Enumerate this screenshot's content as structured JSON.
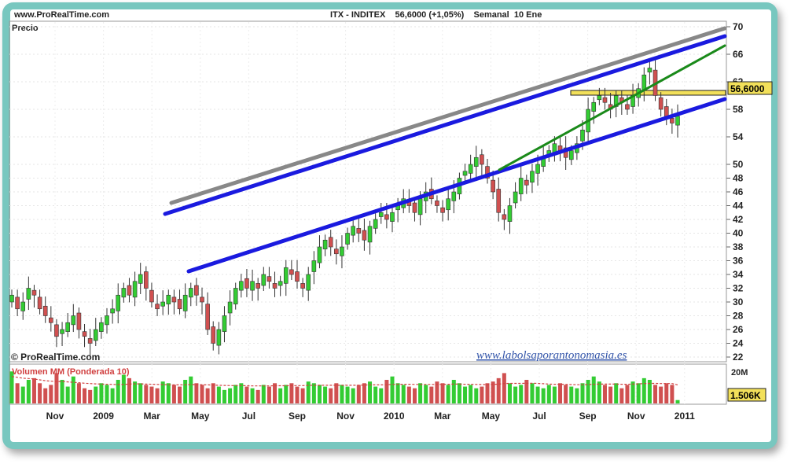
{
  "header": {
    "site": "www.ProRealTime.com",
    "title": "ITX - INDITEX    56,6000 (+1,05%)    Semanal  10 Ene"
  },
  "price_panel": {
    "label": "Precio",
    "copyright": "© ProRealTime.com",
    "watermark": "www.labolsaporantonomasia.es",
    "last_price_tag": "56,6000"
  },
  "volume_panel": {
    "label": "Volumen MM (Ponderada 10)",
    "top_tick": "20M",
    "last_volume_tag": "1.506K"
  },
  "colors": {
    "up_candle": "#33cc33",
    "down_candle": "#d05050",
    "channel_line": "#1a1adf",
    "outer_line": "#888888",
    "trend_line": "#1a8a1a",
    "support_band": "#f2e05a",
    "frame": "#78c7bf"
  },
  "chart_data": [
    {
      "type": "candlestick",
      "title": "ITX - INDITEX",
      "timeframe": "Semanal",
      "last_value": 56.6,
      "change_pct": 1.05,
      "ylim": [
        21.5,
        71
      ],
      "y_ticks": [
        22,
        24,
        26,
        28,
        30,
        32,
        34,
        36,
        38,
        40,
        42,
        44,
        46,
        48,
        50,
        54,
        58,
        62,
        66,
        70
      ],
      "x_ticks": [
        "Nov",
        "2009",
        "Mar",
        "May",
        "Jul",
        "Sep",
        "Nov",
        "2010",
        "Mar",
        "May",
        "Jul",
        "Sep",
        "Nov",
        "2011"
      ],
      "grid": true,
      "close": [
        31,
        29,
        30,
        32,
        31,
        29,
        28,
        27,
        25,
        26,
        27,
        28,
        26,
        25,
        24,
        26,
        27,
        28,
        29,
        31,
        32,
        31,
        33,
        34,
        32,
        30,
        29,
        30,
        31,
        30,
        29,
        31,
        32,
        31,
        30,
        26,
        24,
        26,
        28,
        30,
        32,
        33,
        32,
        33,
        32,
        34,
        33,
        32,
        33,
        35,
        34,
        33,
        32,
        34,
        36,
        38,
        39,
        38,
        37,
        38,
        40,
        41,
        40,
        39,
        41,
        42,
        43,
        42,
        43,
        44,
        45,
        44,
        43,
        45,
        46,
        45,
        44,
        43,
        45,
        46,
        48,
        49,
        50,
        51,
        50,
        48,
        46,
        43,
        42,
        44,
        46,
        48,
        47,
        49,
        50,
        51,
        52,
        53,
        52,
        51,
        52,
        53,
        55,
        58,
        59,
        60,
        59,
        58,
        60,
        59,
        58,
        60,
        61,
        63,
        64,
        60,
        58,
        57,
        56,
        57
      ]
    },
    {
      "type": "bar",
      "title": "Volumen MM (Ponderada 10)",
      "ylim": [
        0,
        21
      ],
      "y_ticks": [
        "20M"
      ],
      "last_value": "1.506K",
      "values": [
        19,
        12,
        10,
        14,
        15,
        12,
        9,
        11,
        18,
        14,
        10,
        16,
        12,
        9,
        8,
        10,
        12,
        11,
        9,
        14,
        17,
        15,
        13,
        12,
        11,
        10,
        9,
        13,
        12,
        11,
        10,
        14,
        16,
        12,
        11,
        9,
        12,
        10,
        8,
        9,
        11,
        12,
        10,
        9,
        8,
        11,
        10,
        12,
        9,
        11,
        12,
        10,
        9,
        13,
        12,
        11,
        10,
        9,
        12,
        11,
        10,
        9,
        11,
        12,
        13,
        10,
        9,
        14,
        16,
        12,
        11,
        10,
        9,
        12,
        11,
        10,
        13,
        12,
        11,
        14,
        12,
        10,
        11,
        9,
        10,
        12,
        13,
        15,
        18,
        12,
        10,
        11,
        14,
        12,
        10,
        9,
        11,
        10,
        12,
        11,
        10,
        9,
        12,
        14,
        16,
        13,
        11,
        10,
        12,
        9,
        11,
        13,
        12,
        15,
        14,
        11,
        10,
        12,
        11,
        2
      ],
      "moving_average": [
        16,
        15.5,
        15,
        14.8,
        14.5,
        14,
        13.5,
        13.2,
        13,
        13,
        12.8,
        12.5,
        12.3,
        12,
        11.8,
        11.6,
        11.5,
        11.4,
        11.3,
        11.2,
        11.3,
        11.5,
        11.6,
        11.6,
        11.5,
        11.4,
        11.3,
        11.2,
        11.1,
        11,
        11,
        11.1,
        11.2,
        11.2,
        11.1,
        11,
        10.9,
        10.8,
        10.7,
        10.6,
        10.6,
        10.6,
        10.5,
        10.4,
        10.4,
        10.4,
        10.4,
        10.5,
        10.5,
        10.5,
        10.6,
        10.6,
        10.6,
        10.7,
        10.8,
        10.8,
        10.8,
        10.8,
        10.8,
        10.8,
        10.8,
        10.8,
        10.8,
        10.9,
        11,
        11,
        11,
        11.1,
        11.3,
        11.4,
        11.4,
        11.4,
        11.3,
        11.3,
        11.3,
        11.3,
        11.3,
        11.3,
        11.4,
        11.5,
        11.5,
        11.4,
        11.4,
        11.3,
        11.2,
        11.2,
        11.3,
        11.5,
        11.8,
        11.9,
        11.9,
        11.9,
        12,
        12,
        11.9,
        11.7,
        11.5,
        11.4,
        11.4,
        11.3,
        11.2,
        11.1,
        11.1,
        11.2,
        11.4,
        11.5,
        11.5,
        11.5,
        11.5,
        11.4,
        11.4,
        11.5,
        11.6,
        11.8,
        11.9,
        11.9,
        11.8,
        11.8,
        11.8,
        11
      ]
    }
  ]
}
